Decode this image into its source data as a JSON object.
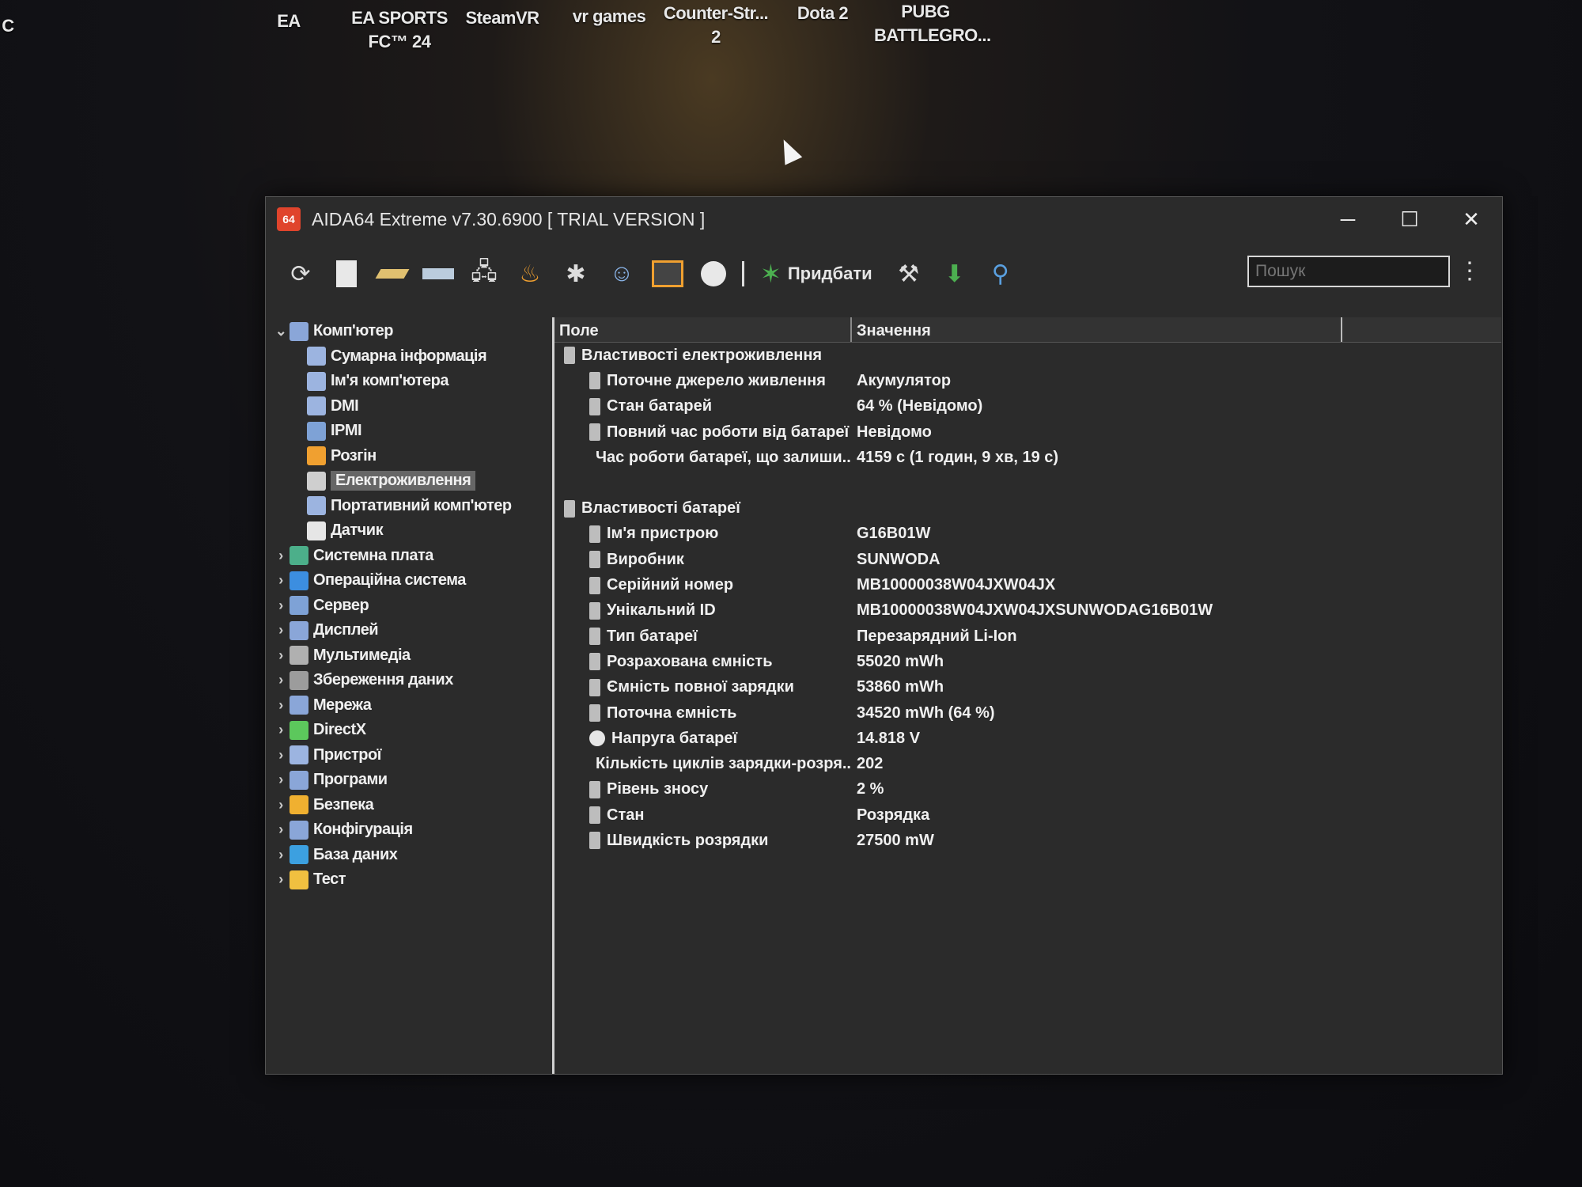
{
  "desktop": {
    "icons": [
      {
        "label": "C"
      },
      {
        "label": "EA"
      },
      {
        "label": "EA SPORTS FC™ 24"
      },
      {
        "label": "SteamVR"
      },
      {
        "label": "vr games"
      },
      {
        "label": "Counter-Str... 2"
      },
      {
        "label": "Dota 2"
      },
      {
        "label": "PUBG BATTLEGRO..."
      }
    ]
  },
  "window": {
    "logo": "64",
    "title": "AIDA64 Extreme v7.30.6900  [ TRIAL VERSION ]",
    "minimize": "─",
    "maximize": "☐",
    "close": "✕"
  },
  "toolbar": {
    "buy_label": "Придбати",
    "search_placeholder": "Пошук"
  },
  "tree": {
    "items": [
      {
        "label": "Комп'ютер",
        "chev": "⌄",
        "indent": 0,
        "color": "#8aa6d8"
      },
      {
        "label": "Сумарна інформація",
        "chev": "",
        "indent": 1,
        "color": "#9cb4e0"
      },
      {
        "label": "Ім'я комп'ютера",
        "chev": "",
        "indent": 1,
        "color": "#9cb4e0"
      },
      {
        "label": "DMI",
        "chev": "",
        "indent": 1,
        "color": "#9cb4e0"
      },
      {
        "label": "IPMI",
        "chev": "",
        "indent": 1,
        "color": "#7ea2d6"
      },
      {
        "label": "Розгін",
        "chev": "",
        "indent": 1,
        "color": "#f0a030"
      },
      {
        "label": "Електроживлення",
        "chev": "",
        "indent": 1,
        "color": "#cfcfcf",
        "selected": true
      },
      {
        "label": "Портативний комп'ютер",
        "chev": "",
        "indent": 1,
        "color": "#9cb4e0"
      },
      {
        "label": "Датчик",
        "chev": "",
        "indent": 1,
        "color": "#e6e6e6"
      },
      {
        "label": "Системна плата",
        "chev": "›",
        "indent": 0,
        "color": "#4caf8a"
      },
      {
        "label": "Операційна система",
        "chev": "›",
        "indent": 0,
        "color": "#3c8ee0"
      },
      {
        "label": "Сервер",
        "chev": "›",
        "indent": 0,
        "color": "#7ea2d6"
      },
      {
        "label": "Дисплей",
        "chev": "›",
        "indent": 0,
        "color": "#8aa6d8"
      },
      {
        "label": "Мультимедіа",
        "chev": "›",
        "indent": 0,
        "color": "#b0b0b0"
      },
      {
        "label": "Збереження даних",
        "chev": "›",
        "indent": 0,
        "color": "#9c9c9c"
      },
      {
        "label": "Мережа",
        "chev": "›",
        "indent": 0,
        "color": "#8aa6d8"
      },
      {
        "label": "DirectX",
        "chev": "›",
        "indent": 0,
        "color": "#5cc85c"
      },
      {
        "label": "Пристрої",
        "chev": "›",
        "indent": 0,
        "color": "#9cb4e0"
      },
      {
        "label": "Програми",
        "chev": "›",
        "indent": 0,
        "color": "#8aa6d8"
      },
      {
        "label": "Безпека",
        "chev": "›",
        "indent": 0,
        "color": "#f0b030"
      },
      {
        "label": "Конфігурація",
        "chev": "›",
        "indent": 0,
        "color": "#8aa6d8"
      },
      {
        "label": "База даних",
        "chev": "›",
        "indent": 0,
        "color": "#3ca0e0"
      },
      {
        "label": "Тест",
        "chev": "›",
        "indent": 0,
        "color": "#f0c040"
      }
    ]
  },
  "list": {
    "col_field": "Поле",
    "col_value": "Значення",
    "rows": [
      {
        "kind": "group",
        "field": "Властивості електроживлення",
        "value": ""
      },
      {
        "kind": "item",
        "field": "Поточне джерело живлення",
        "value": "Акумулятор"
      },
      {
        "kind": "item",
        "field": "Стан батарей",
        "value": "64 % (Невідомо)"
      },
      {
        "kind": "item",
        "field": "Повний час роботи від батареї",
        "value": "Невідомо"
      },
      {
        "kind": "item",
        "field": "Час роботи батареї, що залиши...",
        "value": "4159 с (1 годин, 9 хв, 19 с)"
      },
      {
        "kind": "spacer",
        "field": "",
        "value": ""
      },
      {
        "kind": "group",
        "field": "Властивості батареї",
        "value": ""
      },
      {
        "kind": "item",
        "field": "Ім'я пристрою",
        "value": "G16B01W"
      },
      {
        "kind": "item",
        "field": "Виробник",
        "value": "SUNWODA"
      },
      {
        "kind": "item",
        "field": "Серійний номер",
        "value": "MB10000038W04JXW04JX"
      },
      {
        "kind": "item",
        "field": "Унікальний ID",
        "value": "MB10000038W04JXW04JXSUNWODAG16B01W"
      },
      {
        "kind": "item",
        "field": "Тип батареї",
        "value": "Перезарядний Li-Ion"
      },
      {
        "kind": "item",
        "field": "Розрахована ємність",
        "value": "55020 mWh"
      },
      {
        "kind": "item",
        "field": "Ємність повної зарядки",
        "value": "53860 mWh"
      },
      {
        "kind": "item",
        "field": "Поточна ємність",
        "value": "34520 mWh  (64 %)"
      },
      {
        "kind": "item",
        "field": "Напруга батареї",
        "value": "14.818 V",
        "round": true
      },
      {
        "kind": "item",
        "field": "Кількість циклів зарядки-розря...",
        "value": "202"
      },
      {
        "kind": "item",
        "field": "Рівень зносу",
        "value": "2 %"
      },
      {
        "kind": "item",
        "field": "Стан",
        "value": "Розрядка"
      },
      {
        "kind": "item",
        "field": "Швидкість розрядки",
        "value": "27500 mW"
      }
    ]
  }
}
